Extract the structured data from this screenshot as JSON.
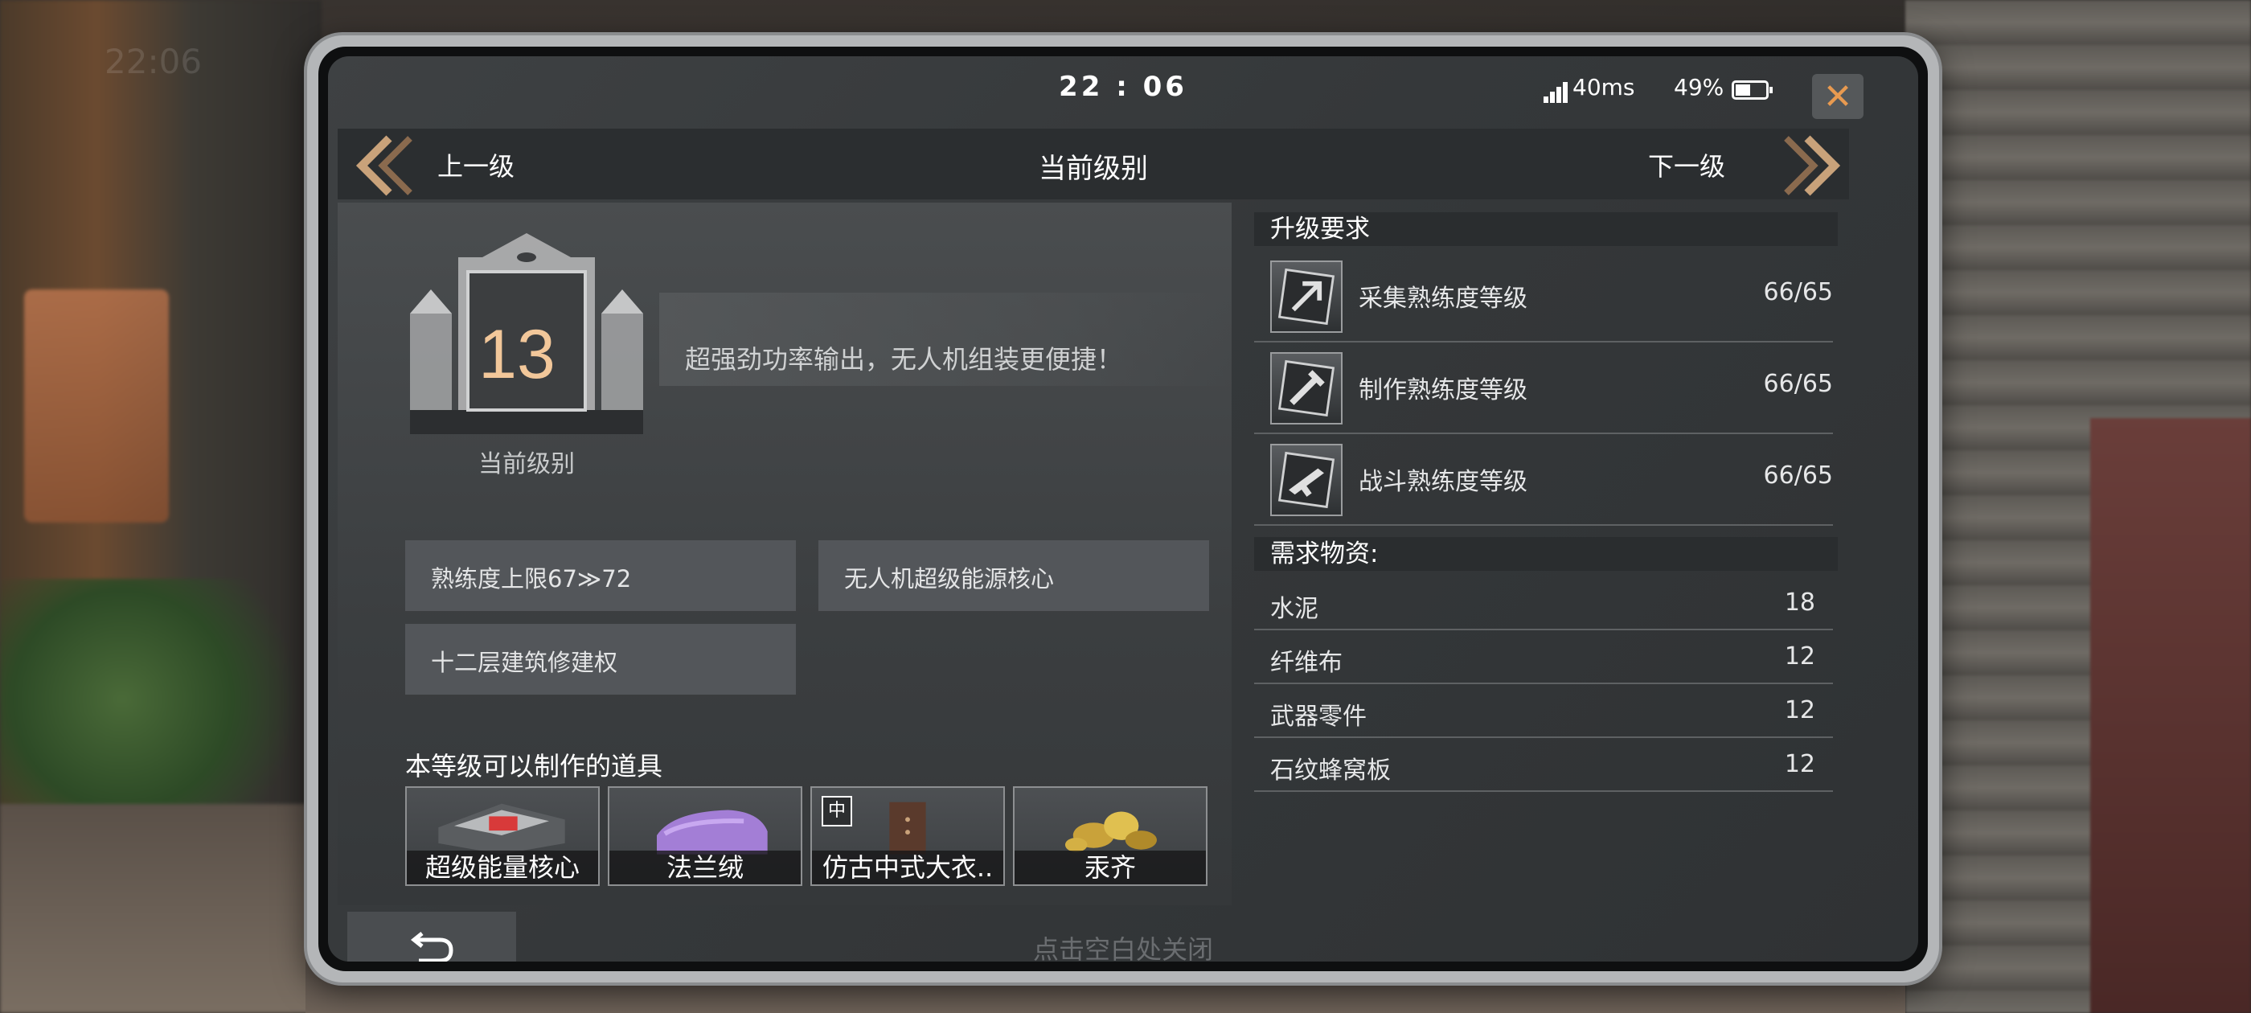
{
  "background": {
    "time": "22:06"
  },
  "status_bar": {
    "time": "22 : 06",
    "ping": "40ms",
    "battery": "49%",
    "battery_level": 0.49
  },
  "nav": {
    "prev_label": "上一级",
    "title": "当前级别",
    "next_label": "下一级"
  },
  "level": {
    "number": "13",
    "caption": "当前级别",
    "description": "超强劲功率输出，无人机组装更便捷！"
  },
  "perks": [
    "熟练度上限67≫72",
    "无人机超级能源核心",
    "十二层建筑修建权"
  ],
  "craftable": {
    "title": "本等级可以制作的道具",
    "items": [
      {
        "name": "超级能量核心"
      },
      {
        "name": "法兰绒"
      },
      {
        "name": "仿古中式大衣..",
        "size_badge": "中"
      },
      {
        "name": "汞齐"
      }
    ]
  },
  "requirements": {
    "title": "升级要求",
    "items": [
      {
        "label": "采集熟练度等级",
        "value": "66/65"
      },
      {
        "label": "制作熟练度等级",
        "value": "66/65"
      },
      {
        "label": "战斗熟练度等级",
        "value": "66/65"
      }
    ]
  },
  "materials": {
    "title": "需求物资:",
    "items": [
      {
        "label": "水泥",
        "value": "18"
      },
      {
        "label": "纤维布",
        "value": "12"
      },
      {
        "label": "武器零件",
        "value": "12"
      },
      {
        "label": "石纹蜂窝板",
        "value": "12"
      }
    ]
  },
  "hint": "点击空白处关闭",
  "colors": {
    "accent": "#e89a50",
    "level_number": "#f2c79a",
    "panel": "#53565a"
  }
}
